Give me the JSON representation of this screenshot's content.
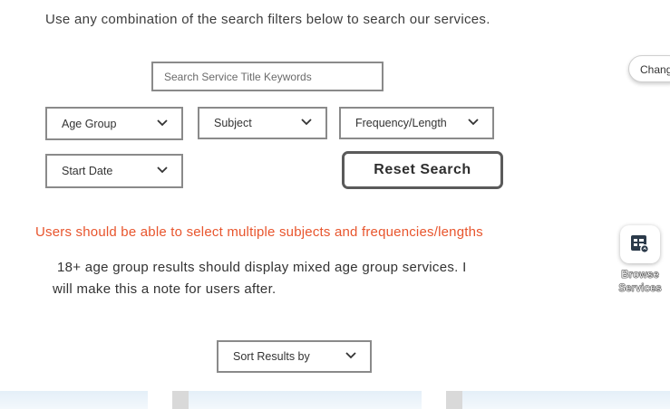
{
  "intro_text": "Use any combination of the search filters below to search our services.",
  "search": {
    "placeholder": "Search Service Title Keywords"
  },
  "filters": {
    "age_group": "Age Group",
    "subject": "Subject",
    "frequency": "Frequency/Length",
    "start_date": "Start Date"
  },
  "reset_label": "Reset Search",
  "note_red": "Users should be able to select multiple subjects and frequencies/lengths",
  "note_line1": "18+ age group results should display mixed age group services. I",
  "note_line2": "will make this a note for users after.",
  "sort_label": "Sort Results by",
  "side": {
    "change_label": "Chang",
    "browse_line1": "Browse",
    "browse_line2": "Services"
  },
  "colors": {
    "note_red": "#e8552d",
    "border": "#8a8a8a"
  }
}
